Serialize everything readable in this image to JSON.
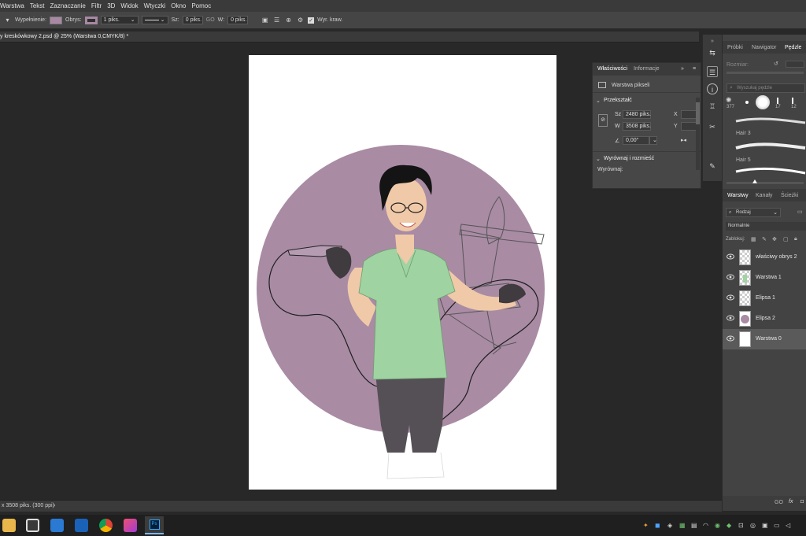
{
  "menu": [
    "Warstwa",
    "Tekst",
    "Zaznaczanie",
    "Filtr",
    "3D",
    "Widok",
    "Wtyczki",
    "Okno",
    "Pomoc"
  ],
  "options": {
    "fill_label": "Wypełnienie:",
    "stroke_label": "Obrys:",
    "stroke_width": "1 piks.",
    "w_label": "Sz:",
    "w_value": "0 piks.",
    "go_label": "GO",
    "h_label": "W:",
    "h_value": "0 piks.",
    "align_edges_label": "Wyr. kraw.",
    "fill_color": "#a888a3",
    "stroke_color": "#a888a3"
  },
  "document": {
    "tab_title": "y kreskówkowy 2.psd @ 25% (Warstwa 0,CMYK/8) *",
    "status": "x 3508 piks. (300 ppi)",
    "status_arrow": "›"
  },
  "properties": {
    "tabs": [
      "Właściwości",
      "Informacje"
    ],
    "layer_type": "Warstwa pikseli",
    "section_transform": "Przekształć",
    "w_label": "Sz",
    "w_value": "2480 piks.",
    "h_label": "W",
    "h_value": "3508 piks.",
    "x_label": "X",
    "y_label": "Y",
    "angle_value": "0,00°",
    "section_align": "Wyrównaj i rozmieść",
    "align_label": "Wyrównaj:"
  },
  "brushes_panel": {
    "tabs": [
      "Próbki",
      "Nawigator",
      "Pędzle"
    ],
    "size_label": "Rozmiar:",
    "search_placeholder": "Wyszukaj pędzle",
    "brush_sizes": [
      "377",
      "17",
      "12"
    ],
    "brush_names": [
      "Hair 3",
      "Hair 5"
    ]
  },
  "layers_panel": {
    "tabs": [
      "Warstwy",
      "Kanały",
      "Ścieżki"
    ],
    "filter_kind": "Rodzaj",
    "blend_mode": "Normalnie",
    "lock_label": "Zablokuj:",
    "layers": [
      {
        "name": "właściwy obrys 2"
      },
      {
        "name": "Warstwa 1"
      },
      {
        "name": "Elipsa 1"
      },
      {
        "name": "Elipsa 2"
      },
      {
        "name": "Warstwa 0"
      }
    ],
    "footer_go": "GO",
    "footer_fx": "fx"
  },
  "colors": {
    "circle": "#a98ba4",
    "scrubs": "#9fd3a1",
    "pants": "#555055",
    "skin": "#f0c9a8"
  }
}
